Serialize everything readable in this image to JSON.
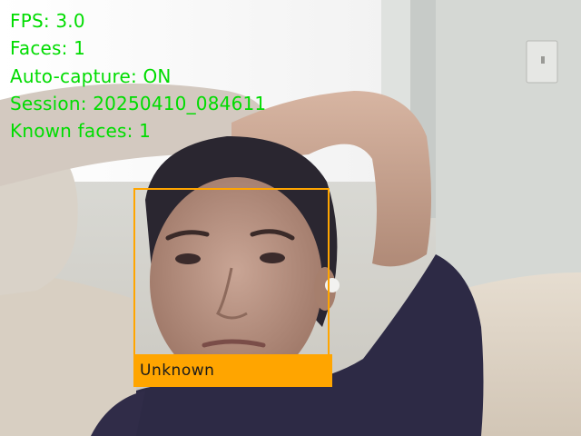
{
  "window": {
    "camera_feed_icon": "webcam-frame"
  },
  "hud": {
    "text_color": "#00dc00",
    "lines": [
      "FPS: 3.0",
      "Faces: 1",
      "Auto-capture: ON",
      "Session: 20250410_084611",
      "Known faces: 1"
    ]
  },
  "detections": [
    {
      "label": "Unknown",
      "box_color": "#ffa500",
      "label_text_color": "#1a1a1a"
    }
  ]
}
